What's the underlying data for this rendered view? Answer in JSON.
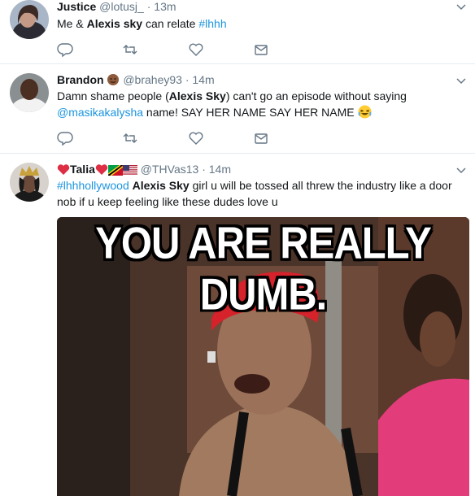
{
  "tweets": [
    {
      "name": "Justice",
      "handle": "@lotusj_",
      "time": "13m",
      "text_parts": [
        "Me & ",
        "Alexis sky",
        " can relate ",
        "#lhhh"
      ]
    },
    {
      "name": "Brandon",
      "handle": "@brahey93",
      "time": "14m",
      "text_parts": [
        "Damn shame people (",
        "Alexis Sky",
        ") can't go an episode without saying",
        "@masikakalysha",
        " name! SAY HER NAME SAY HER NAME "
      ]
    },
    {
      "name": "Talia",
      "handle": "@THVas13",
      "time": "14m",
      "text_parts": [
        "#lhhhollywood",
        " ",
        "Alexis Sky",
        " girl u will be tossed all threw the industry like a door",
        "nob if u keep feeling like these dudes love u"
      ],
      "media_caption": "YOU ARE REALLY DUMB."
    }
  ],
  "separator": "·",
  "icons": [
    "reply-icon",
    "retweet-icon",
    "like-icon",
    "message-icon",
    "chevron-down-icon",
    "emoji-laughing-icon",
    "heart-emoji-icon",
    "flag-icon"
  ],
  "colors": {
    "link": "#1b95e0",
    "secondary": "#657786",
    "divider": "#e6ecf0"
  }
}
